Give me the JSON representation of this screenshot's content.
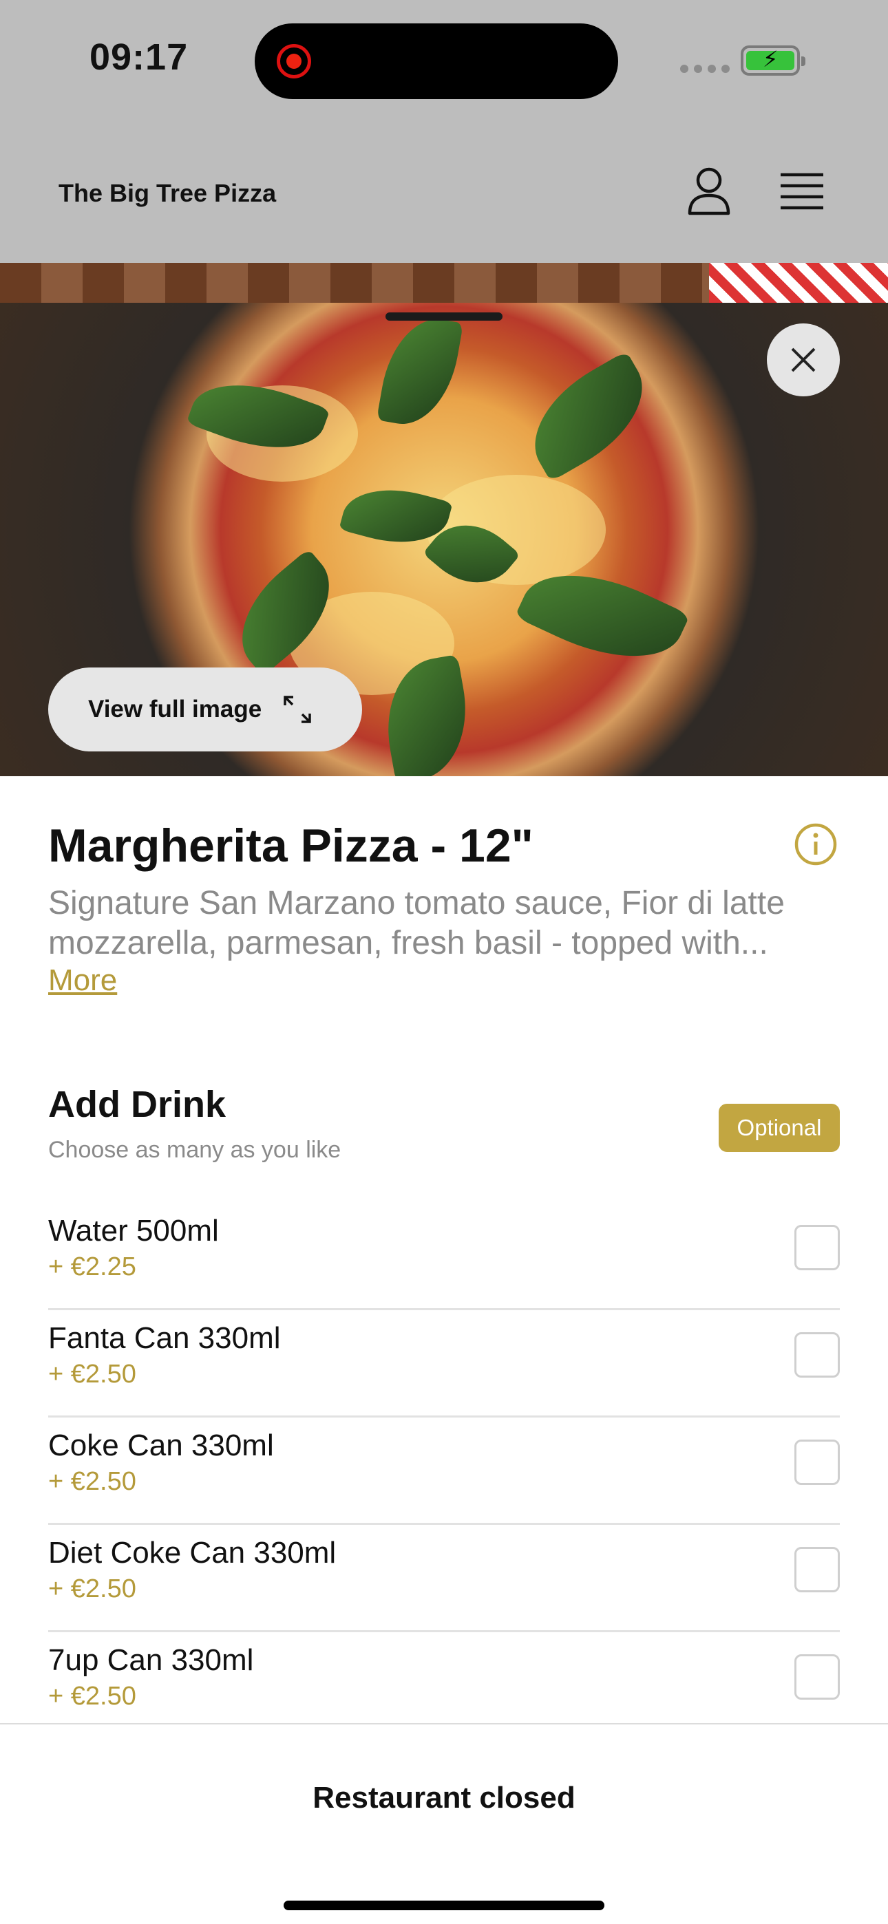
{
  "status_bar": {
    "time": "09:17"
  },
  "header": {
    "brand": "The Big Tree Pizza"
  },
  "image": {
    "view_full_label": "View full image"
  },
  "item": {
    "title": "Margherita Pizza - 12\"",
    "description": "Signature San Marzano tomato sauce, Fior di latte mozzarella, parmesan, fresh basil - topped with...",
    "more_label": "More"
  },
  "drinks_section": {
    "title": "Add Drink",
    "subtitle": "Choose as many as you like",
    "badge": "Optional",
    "items": [
      {
        "name": "Water 500ml",
        "price": "+ €2.25",
        "checked": false
      },
      {
        "name": "Fanta Can 330ml",
        "price": "+ €2.50",
        "checked": false
      },
      {
        "name": "Coke Can 330ml",
        "price": "+ €2.50",
        "checked": false
      },
      {
        "name": "Diet Coke Can 330ml",
        "price": "+ €2.50",
        "checked": false
      },
      {
        "name": "7up Can 330ml",
        "price": "+ €2.50",
        "checked": false
      }
    ]
  },
  "footer": {
    "status": "Restaurant closed"
  },
  "colors": {
    "accent": "#c2a641",
    "price": "#b49a3a",
    "header_bg": "#bdbdbd"
  },
  "icons": [
    "record-icon",
    "signal-icon",
    "battery-icon",
    "profile-icon",
    "menu-icon",
    "close-icon",
    "expand-icon",
    "info-icon"
  ]
}
